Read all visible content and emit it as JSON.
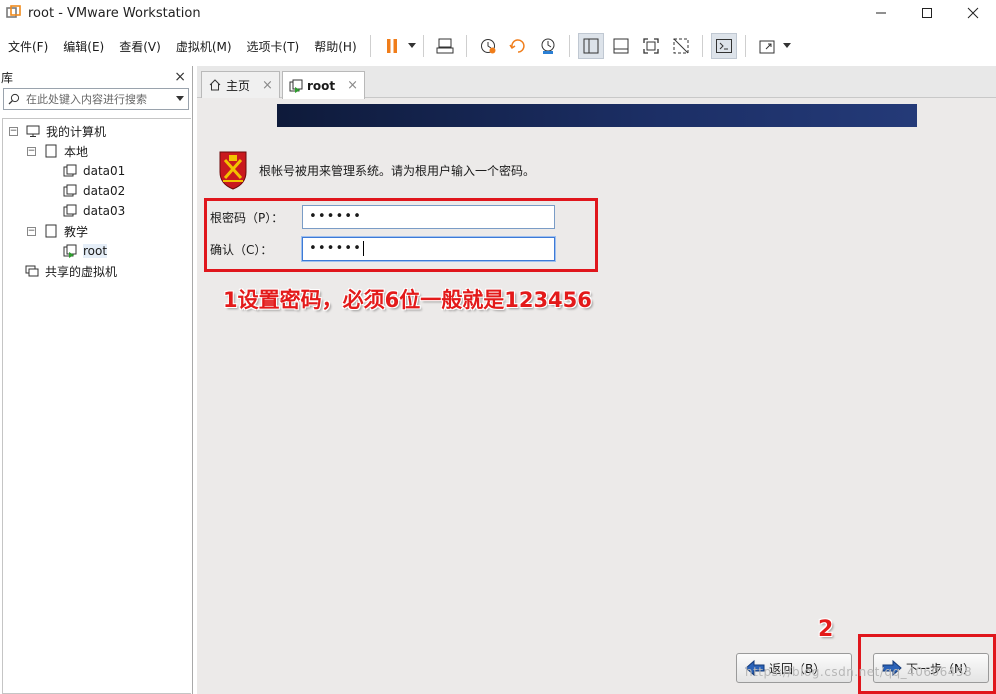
{
  "window": {
    "title": "root - VMware Workstation"
  },
  "menu": [
    "文件(F)",
    "编辑(E)",
    "查看(V)",
    "虚拟机(M)",
    "选项卡(T)",
    "帮助(H)"
  ],
  "toolbar": {
    "icons": [
      "pause-icon",
      "send-keys-icon",
      "snapshot-icon",
      "revert-snapshot-icon",
      "snapshot-manager-icon",
      "library-view-icon",
      "thumbnail-view-icon",
      "fullscreen-icon",
      "unity-icon",
      "console-icon",
      "stretch-icon"
    ],
    "accent_pause": "#f07d1a"
  },
  "sidebar": {
    "title": "库",
    "close": "×",
    "search_placeholder": "在此处键入内容进行搜索",
    "tree": {
      "my_computer": "我的计算机",
      "local": "本地",
      "data01": "data01",
      "data02": "data02",
      "data03": "data03",
      "teaching": "教学",
      "root": "root",
      "shared": "共享的虚拟机"
    }
  },
  "tabs": [
    {
      "label": "主页",
      "close": "×"
    },
    {
      "label": "root",
      "close": "×"
    }
  ],
  "installer": {
    "intro": "根帐号被用来管理系统。请为根用户输入一个密码。",
    "password_label": "根密码（P）：",
    "password_value": "••••••",
    "confirm_label": "确认（C）：",
    "confirm_value": "••••••",
    "back_button": "返回（B）",
    "next_button": "下一步（N）"
  },
  "annotations": {
    "note1": "1设置密码，必须6位一般就是123456",
    "note2": "2",
    "highlight_color": "#e0161c"
  },
  "watermark": "https://blog.csdn.net/qq_40606458"
}
